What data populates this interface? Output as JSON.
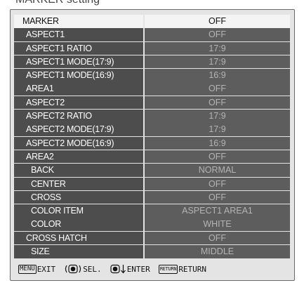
{
  "menu": {
    "rows": [
      {
        "label": "MARKER",
        "value": "OFF"
      },
      {
        "label": "ASPECT1",
        "value": "OFF"
      },
      {
        "label": "ASPECT1 RATIO",
        "value": "17:9"
      },
      {
        "label": "ASPECT1 MODE(17:9)",
        "value": "17:9"
      },
      {
        "label": "ASPECT1 MODE(16:9)",
        "value": "16:9"
      },
      {
        "label": "AREA1",
        "value": "OFF"
      },
      {
        "label": "ASPECT2",
        "value": "OFF"
      },
      {
        "label": "ASPECT2 RATIO",
        "value": "17:9"
      },
      {
        "label": "ASPECT2 MODE(17:9)",
        "value": "17:9"
      },
      {
        "label": "ASPECT2 MODE(16:9)",
        "value": "16:9"
      },
      {
        "label": "AREA2",
        "value": "OFF"
      },
      {
        "label": "BACK",
        "value": "NORMAL"
      },
      {
        "label": "CENTER",
        "value": "OFF"
      },
      {
        "label": "CROSS",
        "value": "OFF"
      },
      {
        "label": "COLOR ITEM",
        "value": "ASPECT1 AREA1"
      },
      {
        "label": "COLOR",
        "value": "WHITE"
      },
      {
        "label": "CROSS HATCH",
        "value": "OFF"
      },
      {
        "label": "SIZE",
        "value": "MIDDLE"
      }
    ],
    "selected_index": 0
  },
  "header": {
    "partial_text": "MARKER setting"
  },
  "footer": {
    "menu_key": "MENU",
    "exit_label": "EXIT",
    "select_label": "SEL.",
    "enter_label": "ENTER",
    "return_key": "RETURN",
    "return_label": "RETURN"
  }
}
